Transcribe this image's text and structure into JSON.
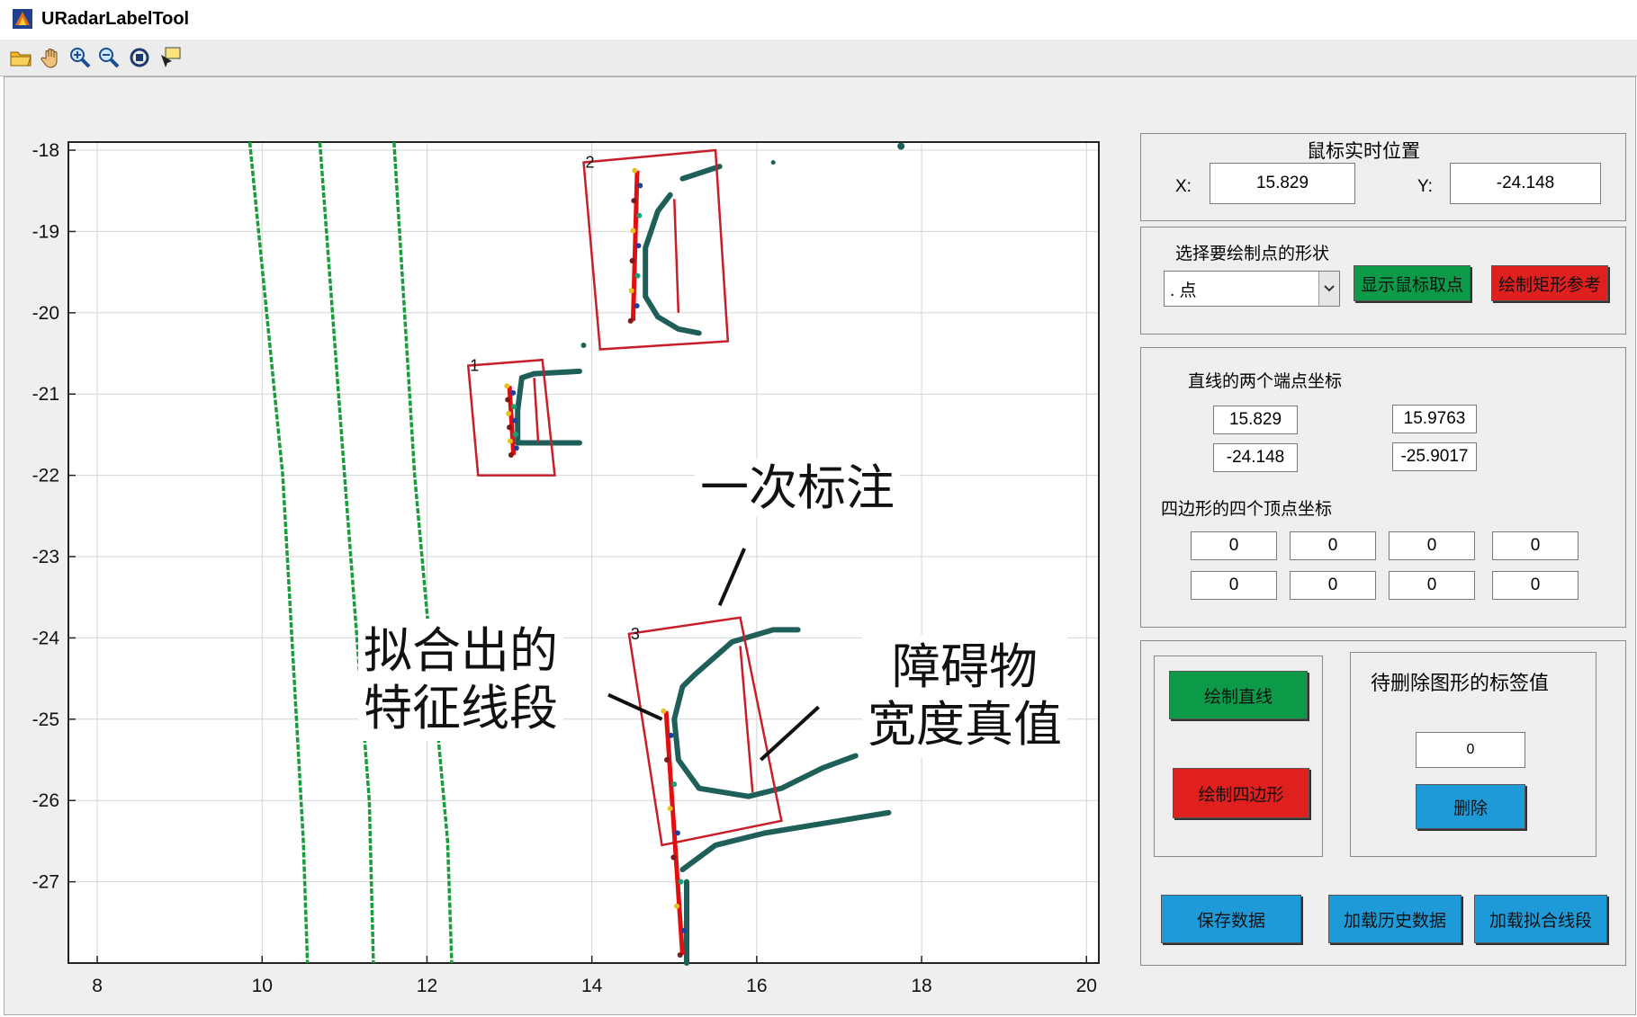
{
  "window": {
    "title": "URadarLabelTool"
  },
  "toolbar": {
    "tools": [
      {
        "name": "open-folder-icon"
      },
      {
        "name": "pan-hand-icon"
      },
      {
        "name": "zoom-in-icon"
      },
      {
        "name": "zoom-out-icon"
      },
      {
        "name": "rotate-3d-icon"
      },
      {
        "name": "data-cursor-icon"
      }
    ]
  },
  "plot": {
    "x_ticks": [
      "8",
      "10",
      "12",
      "14",
      "16",
      "18",
      "20"
    ],
    "y_ticks": [
      "-18",
      "-19",
      "-20",
      "-21",
      "-22",
      "-23",
      "-24",
      "-25",
      "-26",
      "-27"
    ],
    "box_labels": [
      "1",
      "2",
      "3"
    ]
  },
  "chart_data": {
    "type": "scatter",
    "xlim": [
      7.65,
      20.15
    ],
    "ylim": [
      -28.0,
      -17.9
    ],
    "grid": true,
    "x_ticks": [
      8,
      10,
      12,
      14,
      16,
      18,
      20
    ],
    "y_ticks": [
      -18,
      -19,
      -20,
      -21,
      -22,
      -23,
      -24,
      -25,
      -26,
      -27
    ],
    "lane_lines": [
      {
        "color": "#1a9c3a",
        "points": [
          [
            9.85,
            -17.9
          ],
          [
            10.25,
            -22
          ],
          [
            10.5,
            -26.5
          ],
          [
            10.55,
            -28
          ]
        ]
      },
      {
        "color": "#1a9c3a",
        "points": [
          [
            10.7,
            -17.9
          ],
          [
            11.0,
            -22
          ],
          [
            11.3,
            -26
          ],
          [
            11.35,
            -28
          ]
        ]
      },
      {
        "color": "#1a9c3a",
        "points": [
          [
            11.6,
            -17.9
          ],
          [
            11.85,
            -22
          ],
          [
            12.25,
            -26.5
          ],
          [
            12.3,
            -28
          ]
        ]
      }
    ],
    "boxes": [
      {
        "label": "1",
        "color": "#c81e2a",
        "corners": [
          [
            12.5,
            -20.65
          ],
          [
            13.4,
            -20.58
          ],
          [
            13.55,
            -22.0
          ],
          [
            12.62,
            -22.0
          ]
        ]
      },
      {
        "label": "2",
        "color": "#c81e2a",
        "corners": [
          [
            13.9,
            -18.15
          ],
          [
            15.5,
            -18.0
          ],
          [
            15.65,
            -20.35
          ],
          [
            14.1,
            -20.45
          ]
        ]
      },
      {
        "label": "3",
        "color": "#c81e2a",
        "corners": [
          [
            14.45,
            -23.95
          ],
          [
            15.8,
            -23.75
          ],
          [
            16.3,
            -26.25
          ],
          [
            14.85,
            -26.55
          ]
        ]
      }
    ],
    "fitted_segments": [
      {
        "box": "1",
        "points": [
          [
            13.0,
            -20.9
          ],
          [
            13.05,
            -21.75
          ]
        ]
      },
      {
        "box": "2",
        "points": [
          [
            14.55,
            -18.25
          ],
          [
            14.5,
            -20.1
          ]
        ]
      },
      {
        "box": "3",
        "points": [
          [
            14.9,
            -24.9
          ],
          [
            15.1,
            -27.9
          ]
        ]
      }
    ]
  },
  "annotations": {
    "first_label": "一次标注",
    "fitted_segment_line1": "拟合出的",
    "fitted_segment_line2": "特征线段",
    "obstacle_width_line1": "障碍物",
    "obstacle_width_line2": "宽度真值"
  },
  "mouse_panel": {
    "title": "鼠标实时位置",
    "x_label": "X:",
    "x_value": "15.829",
    "y_label": "Y:",
    "y_value": "-24.148"
  },
  "shape_panel": {
    "title": "选择要绘制点的形状",
    "selected_shape": ". 点",
    "show_mouse_points_label": "显示鼠标取点",
    "draw_rect_ref_label": "绘制矩形参考"
  },
  "endpoints_panel": {
    "line_title": "直线的两个端点坐标",
    "p1x": "15.829",
    "p1y": "-24.148",
    "p2x": "15.9763",
    "p2y": "-25.9017",
    "quad_title": "四边形的四个顶点坐标",
    "quad_values": [
      "0",
      "0",
      "0",
      "0",
      "0",
      "0",
      "0",
      "0"
    ]
  },
  "draw_panel": {
    "draw_line_label": "绘制直线",
    "draw_quad_label": "绘制四边形",
    "delete_title": "待删除图形的标签值",
    "delete_value": "0",
    "delete_label": "删除"
  },
  "bottom_buttons": {
    "save_label": "保存数据",
    "load_history_label": "加载历史数据",
    "load_fitted_label": "加载拟合线段"
  },
  "colors": {
    "lane": "#1a9c3a",
    "box": "#c81e2a",
    "point_cloud": "#1f5f5a",
    "segment": "#e01010",
    "btn_green": "#0c9a48",
    "btn_red": "#e01f1f",
    "btn_blue": "#1e9ad8"
  }
}
